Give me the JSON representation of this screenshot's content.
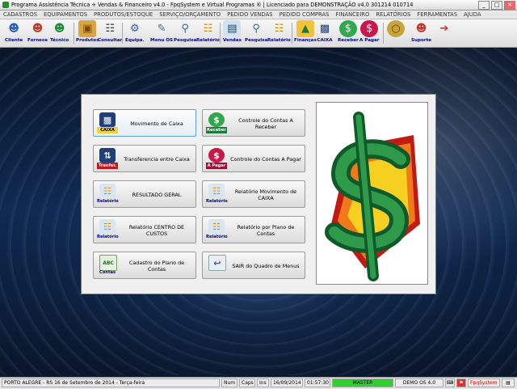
{
  "window": {
    "title": "Programa Assistência Técnica + Vendas & Financeiro v4.0 - FpqSystem e Virtual Programas ® | Licenciado para  DEMONSTRAÇÃO v4.0 301214 010714",
    "minimize": "_",
    "maximize": "□",
    "close": "✕"
  },
  "menu": [
    "CADASTROS",
    "EQUIPAMENTOS",
    "PRODUTOS/ESTOQUE",
    "SERVIÇO/ORÇAMENTO",
    "PEDIDO VENDAS",
    "PEDIDO COMPRAS",
    "FINANCEIRO",
    "RELATÓRIOS",
    "FERRAMENTAS",
    "AJUDA"
  ],
  "toolbar": {
    "cliente": "Cliente",
    "fornece": "Fornece",
    "tecnico": "Técnico",
    "produtos": "Produtos",
    "consultar": "Consultar",
    "equipa": "Equipa.",
    "menu_os": "Menu OS",
    "pesquisa1": "Pesquisa",
    "relatorio1": "Relatório",
    "vendas": "Vendas",
    "pesquisa2": "Pesquisa",
    "relatorio2": "Relatório",
    "financas": "Finanças",
    "caixa": "CAIXA",
    "receber": "Receber",
    "apagar": "A Pagar",
    "suporte": "Suporte"
  },
  "finance_menu": {
    "buttons": {
      "movimento_caixa": {
        "label": "Movimento de Caixa",
        "icon_caption": "CAIXA"
      },
      "contas_receber": {
        "label": "Controle do Contas A Receber",
        "icon_caption": "Receber"
      },
      "transferencia": {
        "label": "Transferencia entre Caixa",
        "icon_caption": "Tranfer."
      },
      "contas_pagar": {
        "label": "Controle do Contas A Pagar",
        "icon_caption": "A Pagar"
      },
      "resultado_geral": {
        "label": "RESULTADO GERAL",
        "icon_caption": "Relatório"
      },
      "rel_mov_caixa": {
        "label": "Relatório Movimento de CAIXA",
        "icon_caption": "Relatório"
      },
      "rel_centro_custos": {
        "label": "Relatório CENTRO DE CUSTOS",
        "icon_caption": "Relatório"
      },
      "rel_plano_contas": {
        "label": "Relatório por Plano de Contas",
        "icon_caption": "Relatório"
      },
      "cad_plano_contas": {
        "label": "Cadastro do Plano de Contas",
        "icon_caption": "Contas",
        "icon_text": "ABC"
      },
      "sair": {
        "label": "SAIR do Quadro de Menus"
      }
    }
  },
  "status": {
    "location_date": "PORTO ALEGRE - RS 16 de Setembro de 2014 - Terça-feira",
    "num": "Num",
    "caps": "Caps",
    "ins": "Ins",
    "date": "16/09/2014",
    "time": "01:57:30",
    "master": "MASTER",
    "demo": "DEMO OS 4.0",
    "brand": "FpqSystem"
  },
  "colors": {
    "accent_blue": "#00008b",
    "master_green": "#2fd12f",
    "dollar_green": "#1f7a3a",
    "dollar_orange": "#f07a1a",
    "dollar_yellow": "#f5d020"
  }
}
